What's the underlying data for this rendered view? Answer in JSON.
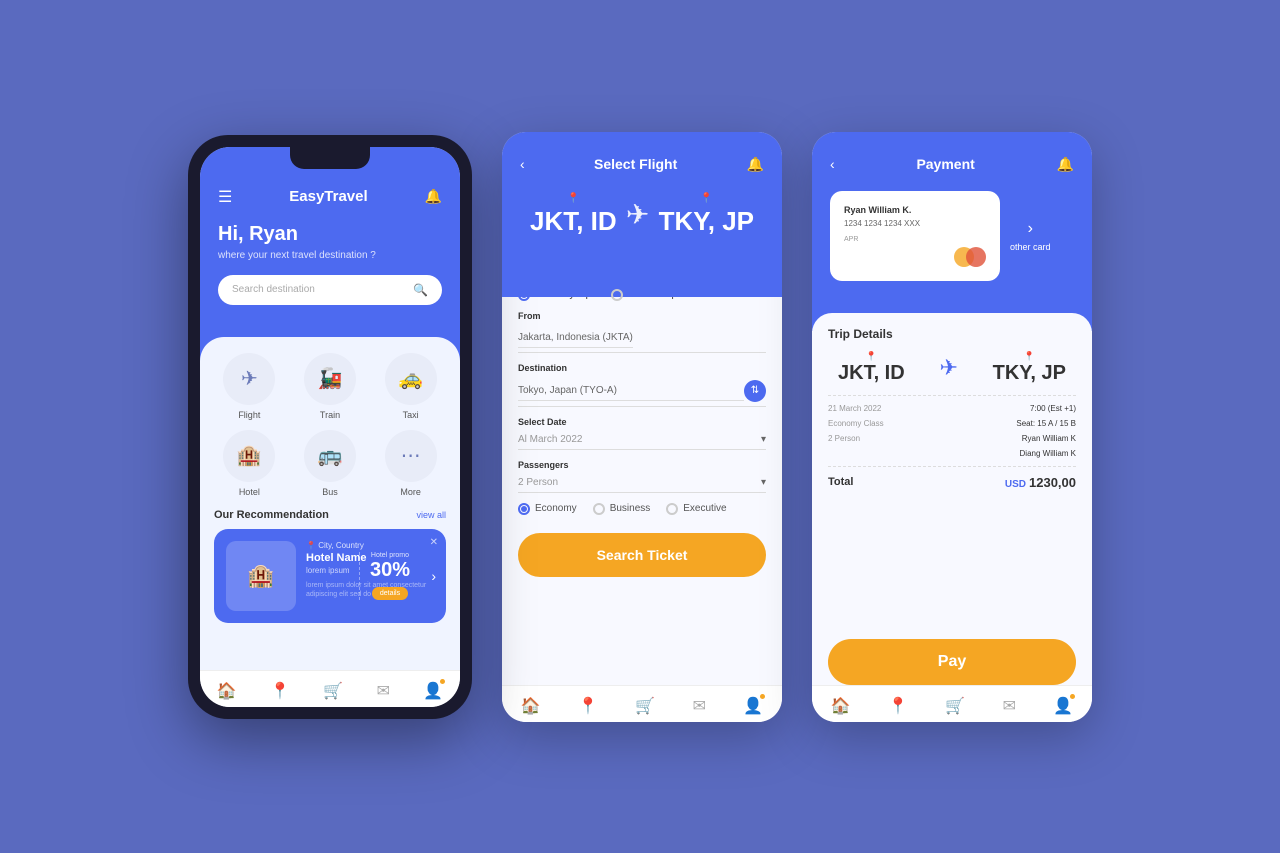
{
  "background": "#5a6abf",
  "phone1": {
    "title": "EasyTravel",
    "greeting": "Hi, Ryan",
    "subtitle": "where your next travel destination ?",
    "search_placeholder": "Search destination",
    "categories": [
      {
        "label": "Flight",
        "icon": "✈"
      },
      {
        "label": "Train",
        "icon": "🚂"
      },
      {
        "label": "Taxi",
        "icon": "🚕"
      },
      {
        "label": "Hotel",
        "icon": "🏨"
      },
      {
        "label": "Bus",
        "icon": "🚌"
      },
      {
        "label": "More",
        "icon": "⋯"
      }
    ],
    "recommendation_title": "Our Recommendation",
    "view_all": "view all",
    "hotel": {
      "location": "City, Country",
      "name": "Hotel Name",
      "sub": "lorem ipsum",
      "promo_label": "Hotel promo",
      "promo_pct": "30%",
      "details_btn": "details"
    },
    "nav_icons": [
      "🏠",
      "📍",
      "🛒",
      "✉",
      "👤"
    ]
  },
  "phone2": {
    "header_title": "Select Flight",
    "origin_code": "JKT, ID",
    "dest_code": "TKY, JP",
    "trip_type_one_way": "One way trip",
    "trip_type_round": "Round Trip",
    "from_label": "From",
    "from_value": "Jakarta, Indonesia (JKTA)",
    "dest_label": "Destination",
    "dest_value": "Tokyo, Japan (TYO-A)",
    "date_label": "Select Date",
    "date_value": "Al March 2022",
    "passengers_label": "Passengers",
    "passengers_value": "2 Person",
    "class_economy": "Economy",
    "class_business": "Business",
    "class_executive": "Executive",
    "search_btn": "Search Ticket",
    "nav_icons": [
      "🏠",
      "📍",
      "🛒",
      "✉",
      "👤"
    ]
  },
  "phone3": {
    "header_title": "Payment",
    "card_name": "Ryan William K.",
    "card_number": "1234 1234 1234 XXX",
    "card_cvv": "APR",
    "other_card": "other card",
    "trip_details_title": "Trip Details",
    "origin_code": "JKT, ID",
    "dest_code": "TKY, JP",
    "details": [
      {
        "label": "21 March 2022",
        "value": "7:00 (Est +1)"
      },
      {
        "label": "Economy Class",
        "value": "Seat: 15 A / 15 B"
      },
      {
        "label": "2 Person",
        "value": "Ryan William K"
      },
      {
        "label": "",
        "value": "Diang William K"
      }
    ],
    "total_label": "Total",
    "total_currency": "USD",
    "total_value": "1230,00",
    "pay_btn": "Pay",
    "nav_icons": [
      "🏠",
      "📍",
      "🛒",
      "✉",
      "👤"
    ]
  }
}
